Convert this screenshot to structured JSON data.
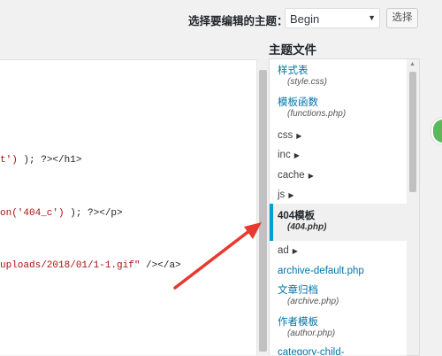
{
  "topbar": {
    "theme_label": "选择要编辑的主题：",
    "theme_value": "Begin",
    "select_button": "选择"
  },
  "editor": {
    "lines": [
      {
        "str": "t')",
        "rest": " ); ?></h1>"
      },
      {
        "str": "on('404_c')",
        "rest": " ); ?></p>"
      },
      {
        "str": "uploads/2018/01/1-1.gif\"",
        "rest": " /></a>"
      }
    ]
  },
  "files": {
    "heading": "主题文件",
    "style": {
      "label": "样式表",
      "file": "(style.css)"
    },
    "functions": {
      "label": "模板函数",
      "file": "(functions.php)"
    },
    "folders": [
      "css",
      "inc",
      "cache",
      "js"
    ],
    "current": {
      "label": "404模板",
      "file": "(404.php)"
    },
    "ad": "ad",
    "archive_default": "archive-default.php",
    "archive": {
      "label": "文章归档",
      "file": "(archive.php)"
    },
    "author": {
      "label": "作者模板",
      "file": "(author.php)"
    },
    "category_child": "category-child-"
  },
  "colors": {
    "link": "#0073aa",
    "accent": "#00a0d2",
    "annotation_arrow": "#e8382f"
  }
}
